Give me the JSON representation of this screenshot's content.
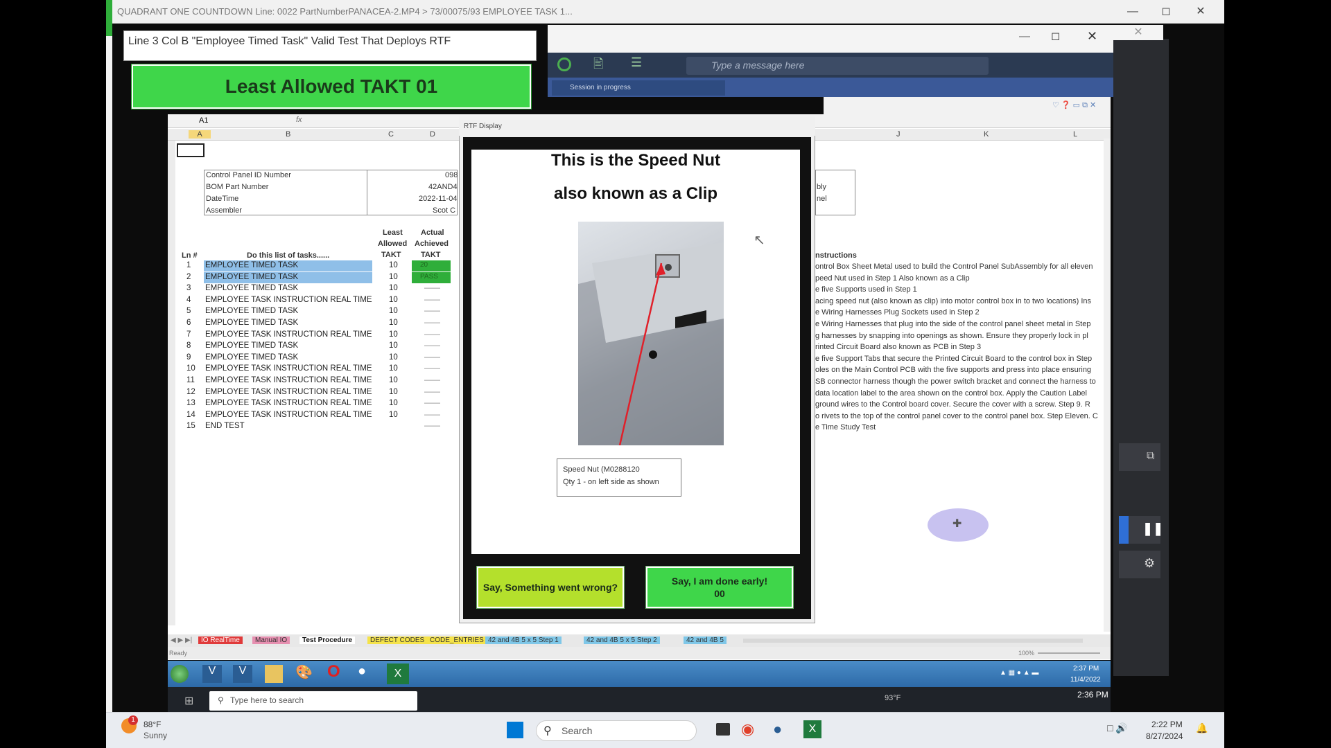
{
  "outer_window": {
    "title": "QUADRANT ONE COUNTDOWN  Line: 0022 PartNumberPANACEA-2.MP4 > 73/00075/93 EMPLOYEE TASK 1..."
  },
  "top_left": {
    "message": "Line 3 Col B \"Employee Timed Task\" Valid Test That Deploys RTF",
    "takt_banner": "Least Allowed TAKT 01"
  },
  "teams": {
    "message_placeholder": "Type a message here",
    "session_status": "Session in progress"
  },
  "sheet": {
    "name_box": "A1",
    "formula_icon": "fx",
    "columns": [
      "A",
      "B",
      "C",
      "D",
      "J",
      "K",
      "L"
    ],
    "header_block": [
      {
        "label": "Control Panel ID Number",
        "value": "098"
      },
      {
        "label": "BOM Part Number",
        "value": "42AND4"
      },
      {
        "label": "DateTime",
        "value": "2022-11-04"
      },
      {
        "label": "Assembler",
        "value": "Scot C"
      }
    ],
    "header_right": [
      "bly",
      "nel"
    ],
    "table_headers": {
      "ln": "Ln #",
      "task": "Do this list of tasks......",
      "least_allowed": [
        "Least",
        "Allowed",
        "TAKT"
      ],
      "actual_achieved": [
        "Actual",
        "Achieved",
        "TAKT"
      ]
    },
    "rows": [
      {
        "ln": "1",
        "task": "EMPLOYEE TIMED TASK",
        "least": "10",
        "actual": "20",
        "highlight": true,
        "status": "pass"
      },
      {
        "ln": "2",
        "task": "EMPLOYEE TIMED TASK",
        "least": "10",
        "actual": "PASS",
        "highlight": true,
        "status": "pass"
      },
      {
        "ln": "3",
        "task": "EMPLOYEE TIMED TASK",
        "least": "10",
        "actual": "——"
      },
      {
        "ln": "4",
        "task": "EMPLOYEE TASK INSTRUCTION REAL TIME II",
        "least": "10",
        "actual": "——"
      },
      {
        "ln": "5",
        "task": "EMPLOYEE TIMED TASK",
        "least": "10",
        "actual": "——"
      },
      {
        "ln": "6",
        "task": "EMPLOYEE TIMED TASK",
        "least": "10",
        "actual": "——"
      },
      {
        "ln": "7",
        "task": "EMPLOYEE TASK INSTRUCTION REAL TIME II",
        "least": "10",
        "actual": "——"
      },
      {
        "ln": "8",
        "task": "EMPLOYEE TIMED TASK",
        "least": "10",
        "actual": "——"
      },
      {
        "ln": "9",
        "task": "EMPLOYEE TIMED TASK",
        "least": "10",
        "actual": "——"
      },
      {
        "ln": "10",
        "task": "EMPLOYEE TASK INSTRUCTION REAL TIME II",
        "least": "10",
        "actual": "——"
      },
      {
        "ln": "11",
        "task": "EMPLOYEE TASK INSTRUCTION REAL TIME II",
        "least": "10",
        "actual": "——"
      },
      {
        "ln": "12",
        "task": "EMPLOYEE TASK INSTRUCTION REAL TIME II",
        "least": "10",
        "actual": "——"
      },
      {
        "ln": "13",
        "task": "EMPLOYEE TASK INSTRUCTION REAL TIME II",
        "least": "10",
        "actual": "——"
      },
      {
        "ln": "14",
        "task": "EMPLOYEE TASK INSTRUCTION REAL TIME II",
        "least": "10",
        "actual": "——"
      },
      {
        "ln": "15",
        "task": "END TEST",
        "least": "",
        "actual": "——"
      }
    ],
    "instructions_header": "nstructions",
    "instructions": [
      "ontrol Box Sheet Metal used to build the Control Panel SubAssembly for all eleven",
      "peed Nut used in Step 1 Also known as a Clip",
      "e five Supports used in Step 1",
      "acing speed nut (also known as clip) into motor control box in to two locations) Ins",
      "e Wiring Harnesses Plug Sockets used in Step 2",
      "e Wiring Harnesses that plug into the side of the control panel sheet metal in Step",
      "g harnesses by snapping into openings as shown.  Ensure they properly lock in pl",
      "rinted Circuit Board also known as PCB in Step 3",
      "e five Support Tabs that secure the Printed Circuit Board to the control box in Step",
      "oles on the Main Control PCB with the five supports and press into place ensuring",
      "SB connector harness though the power switch bracket and connect the harness to",
      "data location label to the area shown on the control box.  Apply the Caution Label",
      "ground wires to the Control board cover. Secure the cover with a screw.  Step 9. R",
      "o rivets to the top of the control panel cover to the control panel box. Step Eleven. C",
      "e Time Study Test"
    ],
    "sheet_tabs": [
      "IO RealTime",
      "Manual IO",
      "Test Procedure",
      "DEFECT CODES",
      "CODE_ENTRIES",
      "42 and 4B 5 x 5 Step 1",
      "42 and 4B 5 x 5 Step 2",
      "42 and 4B 5"
    ],
    "status": "Ready",
    "zoom": "100%"
  },
  "rtf": {
    "window_title": "RTF Display",
    "heading1": "This is the Speed Nut",
    "heading2": "also known as a Clip",
    "caption_line1": "Speed Nut (M0288120",
    "caption_line2": "Qty 1 - on left side as shown",
    "btn_wrong": "Say, Something went wrong?",
    "btn_done_line1": "Say, I am done early!",
    "btn_done_line2": "00"
  },
  "inner_taskbar": {
    "time": "2:37 PM",
    "date": "11/4/2022"
  },
  "inner_taskbar2": {
    "search_placeholder": "Type here to search",
    "temp": "93°F",
    "time": "2:36 PM"
  },
  "taskbar": {
    "weather_temp": "88°F",
    "weather_desc": "Sunny",
    "weather_badge": "1",
    "search_label": "Search",
    "time": "2:22 PM",
    "date": "8/27/2024"
  },
  "colors": {
    "takt_green": "#3fd64a",
    "button_yellow_green": "#b4e02c",
    "button_green": "#3fd64a",
    "row_highlight": "#8fbfe8",
    "pass_green": "#2fae3a"
  }
}
